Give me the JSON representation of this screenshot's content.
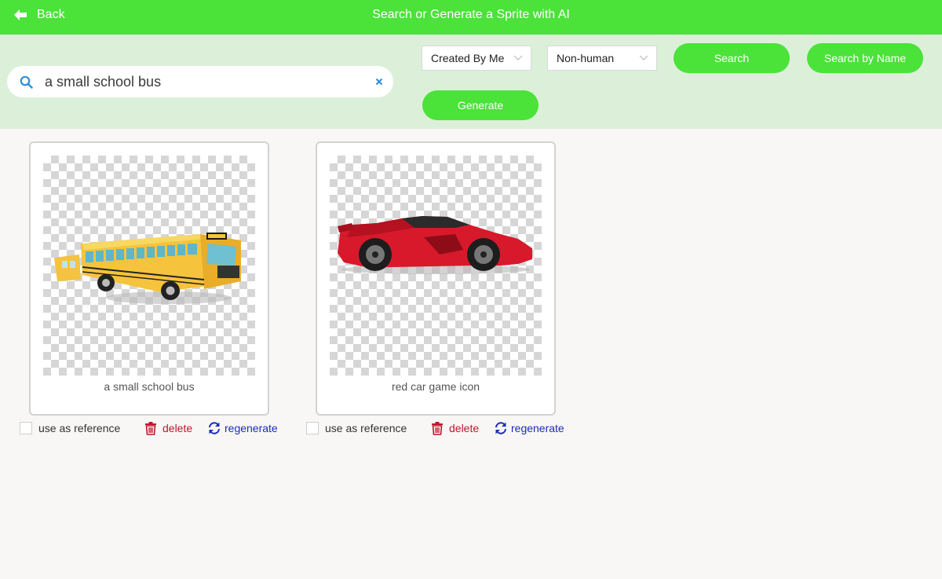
{
  "header": {
    "back_label": "Back",
    "title": "Search or Generate a Sprite with AI",
    "color": "#4be23a"
  },
  "search": {
    "value": "a small school bus",
    "filter_owner": "Created By Me",
    "filter_type": "Non-human",
    "search_label": "Search",
    "search_by_name_label": "Search by Name",
    "generate_label": "Generate"
  },
  "results": [
    {
      "caption": "a small school bus",
      "image": "school-bus-sprite",
      "reference_label": "use as reference",
      "delete_label": "delete",
      "regenerate_label": "regenerate"
    },
    {
      "caption": "red car game icon",
      "image": "red-car-sprite",
      "reference_label": "use as reference",
      "delete_label": "delete",
      "regenerate_label": "regenerate"
    }
  ],
  "icons": {
    "back": "arrow-left-icon",
    "search": "search-icon",
    "clear": "close-icon",
    "chevron": "chevron-down-icon",
    "delete": "trash-icon",
    "regenerate": "refresh-icon"
  },
  "colors": {
    "accent": "#4be23a",
    "panel": "#dcf0d9",
    "delete": "#c0162d",
    "regenerate": "#1b2bbf"
  }
}
